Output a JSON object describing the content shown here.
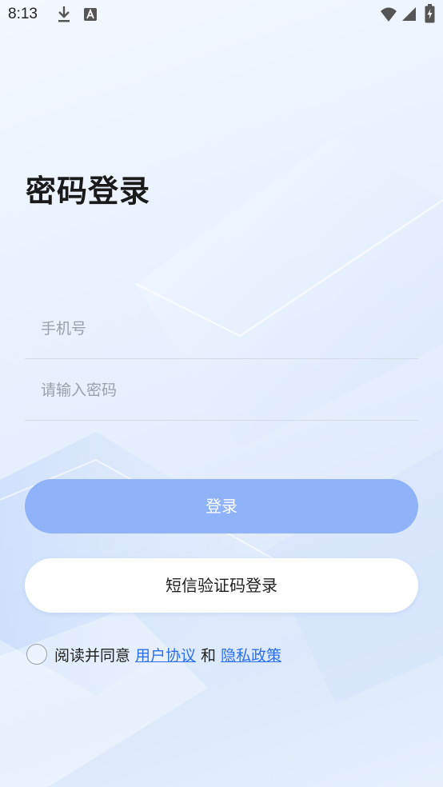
{
  "status_bar": {
    "time": "8:13",
    "icons": [
      "download-icon",
      "app-notification-icon",
      "wifi-icon",
      "signal-icon",
      "battery-charging-icon"
    ]
  },
  "page": {
    "title": "密码登录"
  },
  "form": {
    "phone_placeholder": "手机号",
    "password_placeholder": "请输入密码"
  },
  "buttons": {
    "login": "登录",
    "sms_login": "短信验证码登录"
  },
  "agreement": {
    "prefix": "阅读并同意",
    "user_agreement": "用户协议",
    "and": "和",
    "privacy_policy": "隐私政策",
    "checked": false
  },
  "colors": {
    "primary_button": "#8fb2f8",
    "link": "#2d6ff0",
    "background": "#e8f1fe"
  }
}
